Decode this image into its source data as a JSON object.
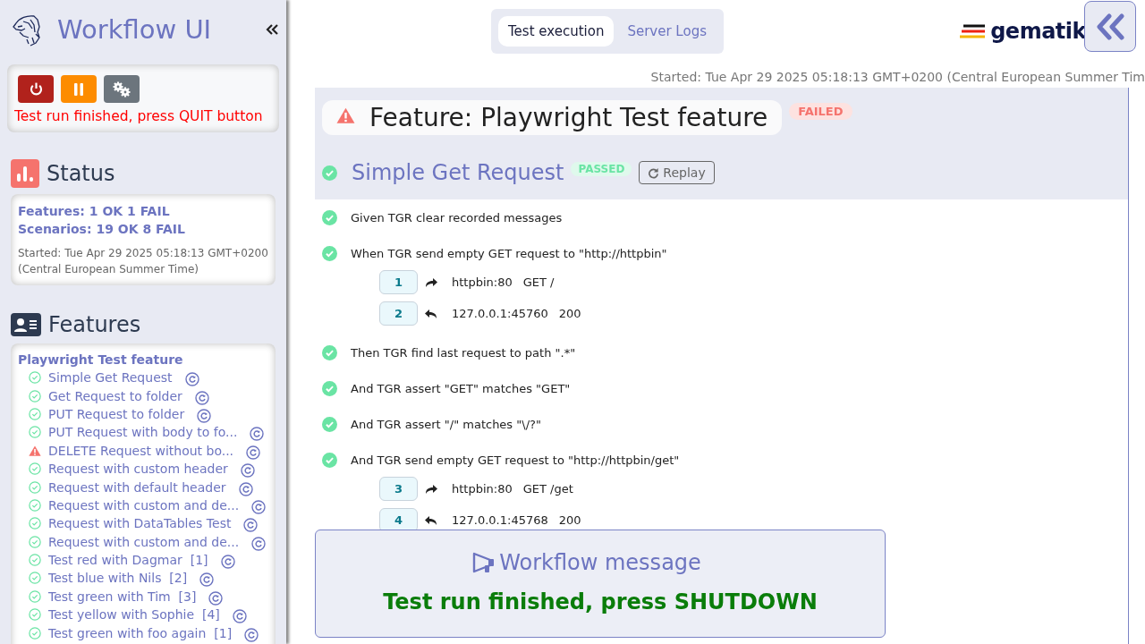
{
  "sidebar": {
    "title": "Workflow UI",
    "controls": [
      {
        "kind": "quit"
      },
      {
        "kind": "pause"
      },
      {
        "kind": "settings"
      }
    ],
    "run_message": "Test run finished, press QUIT button",
    "status": {
      "heading": "Status",
      "features": "Features: 1 OK 1 FAIL",
      "scenarios": "Scenarios: 19 OK 8 FAIL",
      "started": "Started: Tue Apr 29 2025 05:18:13 GMT+0200 (Central European Summer Time)"
    },
    "features": {
      "heading": "Features",
      "feature": "Playwright Test feature",
      "scenarios": [
        {
          "name": "Simple Get Request",
          "failed": false
        },
        {
          "name": "Get Request to folder",
          "failed": false
        },
        {
          "name": "PUT Request to folder",
          "failed": false
        },
        {
          "name": "PUT Request with body to fo...",
          "failed": false
        },
        {
          "name": "DELETE Request without bo...",
          "failed": true
        },
        {
          "name": "Request with custom header",
          "failed": false
        },
        {
          "name": "Request with default header",
          "failed": false
        },
        {
          "name": "Request with custom and de...",
          "failed": false
        },
        {
          "name": "Request with DataTables Test",
          "failed": false
        },
        {
          "name": "Request with custom and de...",
          "failed": false
        },
        {
          "name": "Test red with Dagmar  [1]",
          "failed": false
        },
        {
          "name": "Test blue with Nils  [2]",
          "failed": false
        },
        {
          "name": "Test green with Tim  [3]",
          "failed": false
        },
        {
          "name": "Test yellow with Sophie  [4]",
          "failed": false
        },
        {
          "name": "Test green with foo again  [1]",
          "failed": false
        }
      ]
    }
  },
  "tabs": [
    {
      "label": "Test execution",
      "selected": true
    },
    {
      "label": "Server Logs",
      "selected": false
    }
  ],
  "logo": "gematik",
  "started": "Started: Tue Apr 29 2025 05:18:13 GMT+0200 (Central European Summer Tim",
  "feature": {
    "title": "Feature: Playwright Test feature",
    "failed": true,
    "badge": "FAILED"
  },
  "scenario": {
    "title": "Simple Get Request",
    "failed": false,
    "badge": "PASSED",
    "replay": "Replay",
    "steps": [
      {
        "text": "Given TGR clear recorded messages",
        "failed": false
      },
      {
        "text": "When TGR send empty GET request to \"http://httpbin\"",
        "failed": false,
        "messages": [
          {
            "number": "1",
            "kind": "request",
            "host": "httpbin:80",
            "info": "GET /"
          },
          {
            "number": "2",
            "kind": "response",
            "host": "127.0.0.1:45760",
            "info": "200"
          }
        ]
      },
      {
        "text": "Then TGR find last request to path \".*\"",
        "failed": false
      },
      {
        "text": "And TGR assert \"GET\" matches \"GET\"",
        "failed": false
      },
      {
        "text": "And TGR assert \"/\" matches \"\\/?\"",
        "failed": false
      },
      {
        "text": "And TGR send empty GET request to \"http://httpbin/get\"",
        "failed": false,
        "messages": [
          {
            "number": "3",
            "kind": "request",
            "host": "httpbin:80",
            "info": "GET /get"
          },
          {
            "number": "4",
            "kind": "response",
            "host": "127.0.0.1:45768",
            "info": "200"
          }
        ]
      }
    ]
  },
  "workflow_message": {
    "title": "Workflow message",
    "text": "Test run finished, press SHUTDOWN"
  }
}
